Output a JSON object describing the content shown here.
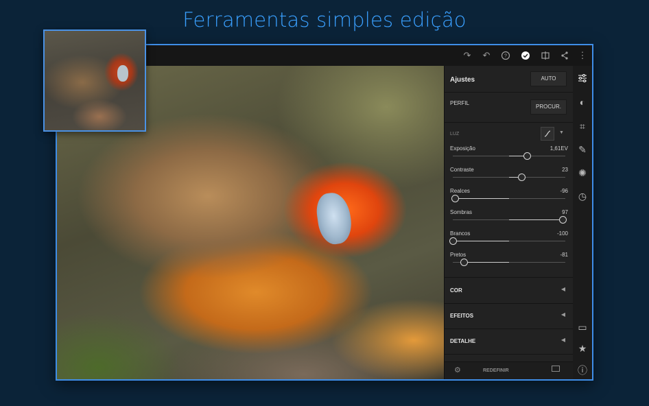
{
  "headline": "Ferramentas simples edição",
  "panel": {
    "title": "Ajustes",
    "auto_label": "AUTO",
    "profile_label": "PERFIL",
    "browse_label": "PROCUR.",
    "light_label": "LUZ",
    "sliders": [
      {
        "name": "Exposição",
        "value": "1,61EV",
        "position": 0.66
      },
      {
        "name": "Contraste",
        "value": "23",
        "position": 0.61
      },
      {
        "name": "Realces",
        "value": "-96",
        "position": 0.02
      },
      {
        "name": "Sombras",
        "value": "97",
        "position": 0.98
      },
      {
        "name": "Brancos",
        "value": "-100",
        "position": 0.0
      },
      {
        "name": "Pretos",
        "value": "-81",
        "position": 0.1
      }
    ],
    "sections": [
      "COR",
      "EFEITOS",
      "DETALHE"
    ],
    "reset_label": "REDEFINIR"
  },
  "toolbar_icons": [
    "redo-icon",
    "undo-icon",
    "help-icon",
    "done-icon",
    "compare-icon",
    "share-icon",
    "more-icon"
  ],
  "rail_icons": [
    "adjust-icon",
    "masks-icon",
    "crop-icon",
    "heal-icon",
    "presets-icon",
    "versions-icon",
    "comment-icon",
    "star-icon",
    "info-icon"
  ],
  "colors": {
    "accent": "#3aa0ff",
    "frame": "#3f8ee8",
    "panel": "#222222"
  }
}
